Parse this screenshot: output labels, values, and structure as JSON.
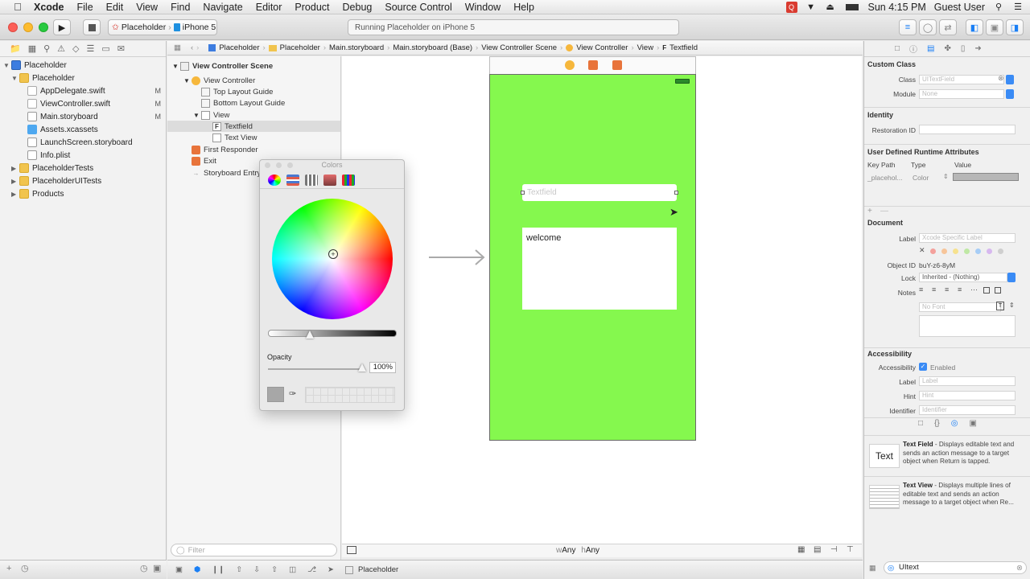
{
  "menubar": {
    "app": "Xcode",
    "items": [
      "File",
      "Edit",
      "View",
      "Find",
      "Navigate",
      "Editor",
      "Product",
      "Debug",
      "Source Control",
      "Window",
      "Help"
    ],
    "clock": "Sun 4:15 PM",
    "user": "Guest User"
  },
  "toolbar": {
    "scheme": "Placeholder",
    "device": "iPhone 5",
    "activity": "Running Placeholder on iPhone 5"
  },
  "navigator": {
    "items": [
      {
        "label": "Placeholder",
        "badge": ""
      },
      {
        "label": "Placeholder",
        "badge": ""
      },
      {
        "label": "AppDelegate.swift",
        "badge": "M"
      },
      {
        "label": "ViewController.swift",
        "badge": "M"
      },
      {
        "label": "Main.storyboard",
        "badge": "M"
      },
      {
        "label": "Assets.xcassets",
        "badge": ""
      },
      {
        "label": "LaunchScreen.storyboard",
        "badge": ""
      },
      {
        "label": "Info.plist",
        "badge": ""
      },
      {
        "label": "PlaceholderTests",
        "badge": ""
      },
      {
        "label": "PlaceholderUITests",
        "badge": ""
      },
      {
        "label": "Products",
        "badge": ""
      }
    ]
  },
  "jumpbar": [
    "Placeholder",
    "Placeholder",
    "Main.storyboard",
    "Main.storyboard (Base)",
    "View Controller Scene",
    "View Controller",
    "View",
    "Textfield"
  ],
  "outline": {
    "items": [
      "View Controller Scene",
      "View Controller",
      "Top Layout Guide",
      "Bottom Layout Guide",
      "View",
      "Textfield",
      "Text View",
      "First Responder",
      "Exit",
      "Storyboard Entry"
    ],
    "textfield_prefix": "F",
    "filter_placeholder": "Filter"
  },
  "canvas": {
    "textfield_placeholder": "Textfield",
    "textview_text": "welcome",
    "size_class_w": "w",
    "size_class_w_val": "Any",
    "size_class_h": "h",
    "size_class_h_val": "Any",
    "background_color": "#85f84e"
  },
  "debugbar": {
    "target": "Placeholder"
  },
  "colors_panel": {
    "title": "Colors",
    "opacity_label": "Opacity",
    "opacity_value": "100%"
  },
  "inspector": {
    "custom_class_title": "Custom Class",
    "class_label": "Class",
    "class_placeholder": "UITextField",
    "module_label": "Module",
    "module_placeholder": "None",
    "identity_title": "Identity",
    "restoration_label": "Restoration ID",
    "udra_title": "User Defined Runtime Attributes",
    "udra_headers": [
      "Key Path",
      "Type",
      "Value"
    ],
    "udra_key": "_placehol...",
    "udra_type": "Color",
    "document_title": "Document",
    "doc_label": "Label",
    "doc_label_placeholder": "Xcode Specific Label",
    "object_id_label": "Object ID",
    "object_id": "buY-z6-8yM",
    "lock_label": "Lock",
    "lock_value": "Inherited - (Nothing)",
    "notes_label": "Notes",
    "notes_font_placeholder": "No Font",
    "accessibility_title": "Accessibility",
    "access_label": "Accessibility",
    "access_enabled": "Enabled",
    "access_label2": "Label",
    "access_label2_placeholder": "Label",
    "hint_label": "Hint",
    "hint_placeholder": "Hint",
    "identifier_label": "Identifier",
    "identifier_placeholder": "Identifier",
    "library": [
      {
        "icon": "Text",
        "title": "Text Field",
        "desc": " - Displays editable text and sends an action message to a target object when Return is tapped."
      },
      {
        "icon": "",
        "title": "Text View",
        "desc": " - Displays multiple lines of editable text and sends an action message to a target object when Re..."
      }
    ],
    "library_filter": "UItext"
  }
}
